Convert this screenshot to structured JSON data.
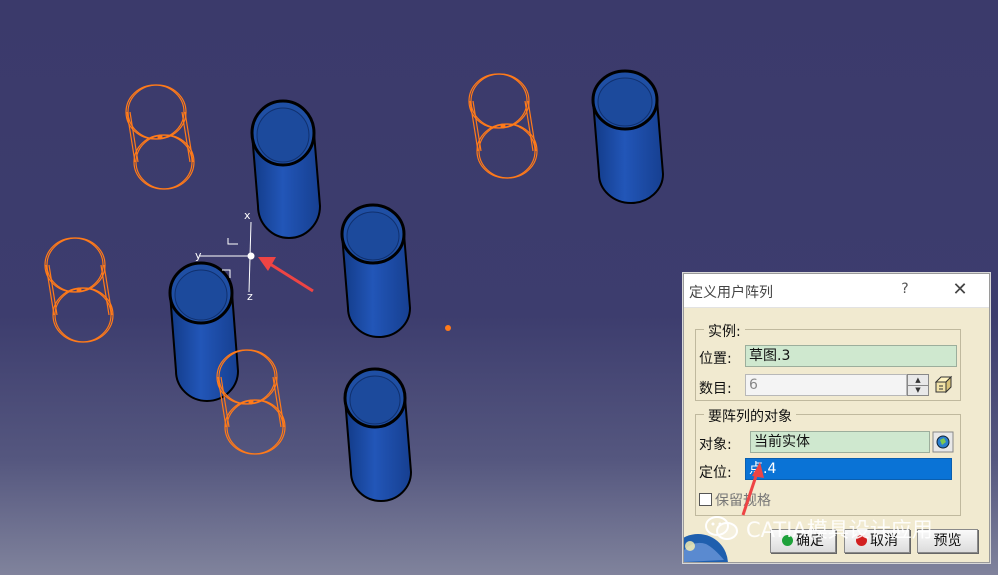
{
  "viewport": {
    "axis_labels": {
      "x": "x",
      "y": "y",
      "z": "z"
    }
  },
  "dialog": {
    "title": "定义用户阵列",
    "help_label": "?",
    "close_label": "✕",
    "instances_group": {
      "title": "实例:",
      "position_label": "位置:",
      "position_value": "草图.3",
      "count_label": "数目:",
      "count_value": "6"
    },
    "objects_group": {
      "title": "要阵列的对象",
      "object_label": "对象:",
      "object_value": "当前实体",
      "anchor_label": "定位:",
      "anchor_value": "点.4"
    },
    "keep_spec_label": "保留规格",
    "ok_label": "确定",
    "cancel_label": "取消",
    "preview_label": "预览",
    "colors": {
      "selection": "#0a73d6",
      "field_green": "#cfe8cf",
      "preview_orange": "#ff7a1a",
      "solid_blue": "#1e4fa8"
    }
  },
  "watermark": "CATIA模具设计应用"
}
